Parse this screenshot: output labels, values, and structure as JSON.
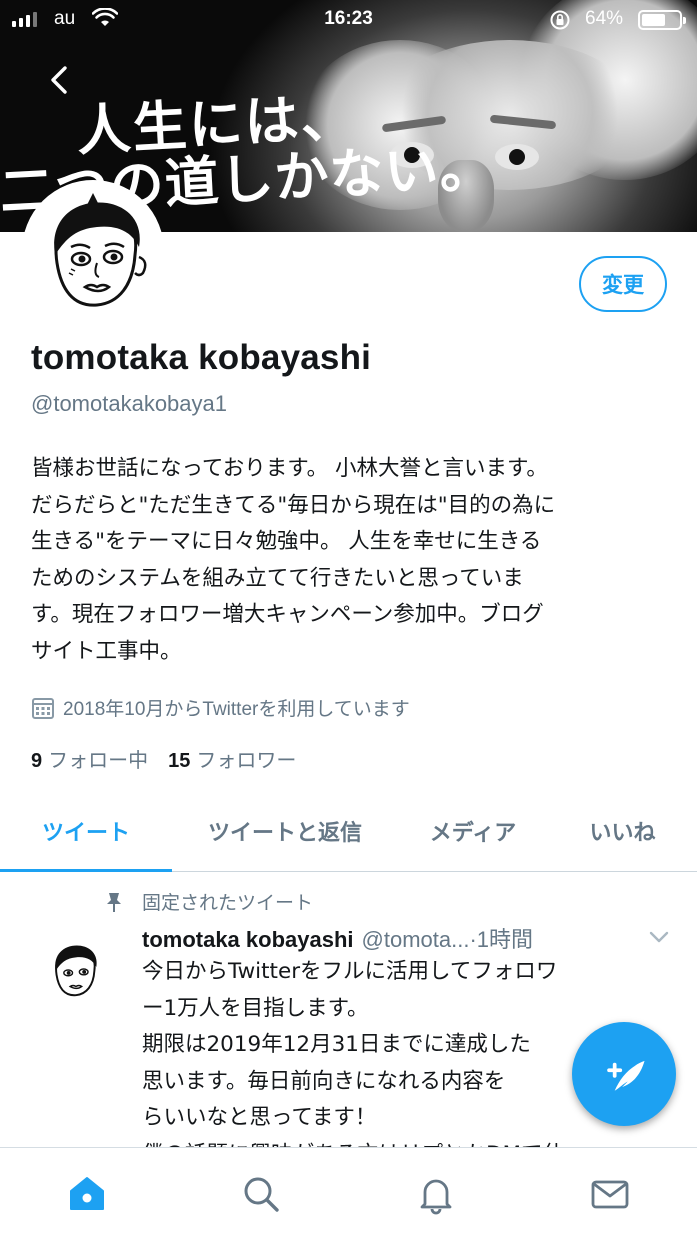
{
  "status_bar": {
    "carrier": "au",
    "time": "16:23",
    "battery_percent": "64%",
    "battery_level": 0.64
  },
  "banner": {
    "line1": "人生には、",
    "line2": "二つの道しかない。"
  },
  "profile": {
    "edit_label": "変更",
    "display_name": "tomotaka kobayashi",
    "handle": "@tomotakakobaya1",
    "bio": "皆様お世話になっております。 小林大誉と言います。\nだらだらと\"ただ生きてる\"毎日から現在は\"目的の為に\n生きる\"をテーマに日々勉強中。 人生を幸せに生きる\nためのシステムを組み立てて行きたいと思っていま\nす。現在フォロワー増大キャンペーン参加中。ブログ\nサイト工事中。",
    "joined": "2018年10月からTwitterを利用しています",
    "following_count": "9",
    "following_label": "フォロー中",
    "followers_count": "15",
    "followers_label": "フォロワー"
  },
  "tabs": [
    {
      "label": "ツイート",
      "active": true
    },
    {
      "label": "ツイートと返信",
      "active": false
    },
    {
      "label": "メディア",
      "active": false
    },
    {
      "label": "いいね",
      "active": false
    }
  ],
  "pinned_tweet": {
    "pinned_label": "固定されたツイート",
    "author_name": "tomotaka kobayashi",
    "author_handle": "@tomota...",
    "time": "·1時間",
    "text": "今日からTwitterをフルに活用してフォロワ\nー1万人を目指します。\n期限は2019年12月31日までに達成した\n思います。毎日前向きになれる内容を\nらいいなと思ってます！\n僕の話題に興味がある方はリプとかDMで仕"
  },
  "icons": {
    "accent": "#1da1f2",
    "secondary_text": "#657786"
  },
  "bottom_nav": [
    "home-icon",
    "search-icon",
    "notifications-icon",
    "messages-icon"
  ]
}
